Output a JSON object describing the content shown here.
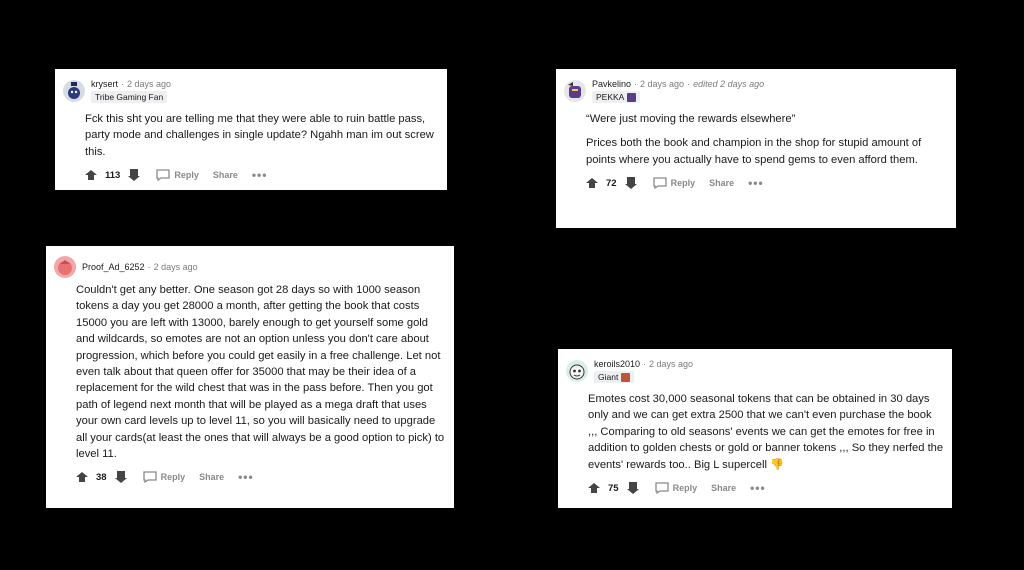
{
  "comments": [
    {
      "username": "krysert",
      "time": "2 days ago",
      "edited": "",
      "flair": "Tribe Gaming Fan",
      "paragraphs": [
        "Fck this sht you are telling me that they were able to ruin battle pass, party mode and challenges in single update? Ngahh man im out screw this."
      ],
      "score": "113",
      "reply_label": "Reply",
      "share_label": "Share",
      "more_label": "•••",
      "avatar_color": "#d9dbe4"
    },
    {
      "username": "Pavkelino",
      "time": "2 days ago",
      "edited": "edited 2 days ago",
      "flair": "PEKKA",
      "paragraphs": [
        "“Were just moving the rewards elsewhere”",
        "Prices both the book and champion in the shop for stupid amount of points where you actually have to spend gems to even afford them."
      ],
      "score": "72",
      "reply_label": "Reply",
      "share_label": "Share",
      "more_label": "•••",
      "avatar_color": "#e6e6ea"
    },
    {
      "username": "Proof_Ad_6252",
      "time": "2 days ago",
      "edited": "",
      "flair": "",
      "paragraphs": [
        "Couldn't get any better. One season got 28 days so with 1000 season tokens a day you get 28000 a month, after getting the book that costs 15000 you are left with 13000, barely enough to get yourself some gold and wildcards, so emotes are not an option unless you don't care about progression, which before you could get easily in a free challenge. Let not even talk about that queen offer for 35000 that may be their idea of a replacement for the wild chest that was in the pass before. Then you got path of legend next month that will be played as a mega draft that uses your own card levels up to level 11, so you will basically need to upgrade all your cards(at least the ones that will always be a good option to pick) to level 11."
      ],
      "score": "38",
      "reply_label": "Reply",
      "share_label": "Share",
      "more_label": "•••",
      "avatar_color": "#f4a6a6"
    },
    {
      "username": "keroils2010",
      "time": "2 days ago",
      "edited": "",
      "flair": "Giant",
      "paragraphs": [
        "Emotes cost 30,000 seasonal tokens that can be obtained in 30 days only and we can get extra 2500 that we can't even purchase the book ,,, Comparing to old seasons' events we can get the emotes for free in addition to golden chests or gold or banner tokens ,,, So they nerfed the events' rewards too.. Big L supercell 👎"
      ],
      "score": "75",
      "reply_label": "Reply",
      "share_label": "Share",
      "more_label": "•••",
      "avatar_color": "#d8efe6"
    }
  ]
}
